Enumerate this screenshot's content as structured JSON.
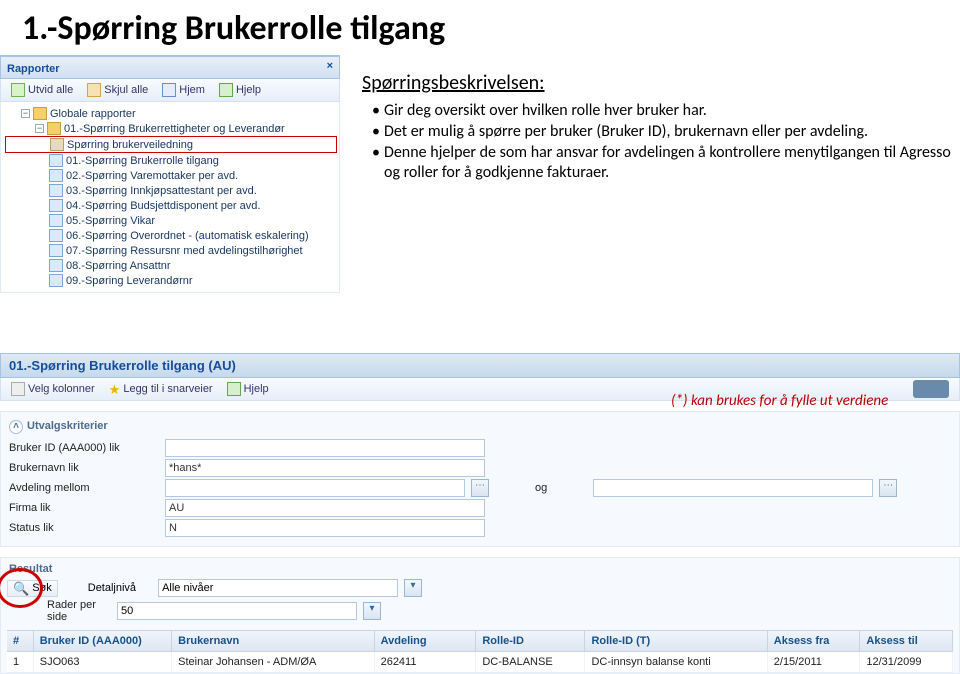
{
  "page_title": "1.-Spørring Brukerrolle tilgang",
  "reports_panel": {
    "title": "Rapporter",
    "close_glyph": "×",
    "toolbar": {
      "expand": "Utvid alle",
      "collapse": "Skjul alle",
      "home": "Hjem",
      "help": "Hjelp"
    },
    "tree": {
      "root": "Globale rapporter",
      "group": "01.-Spørring Brukerrettigheter og Leverandør",
      "highlighted": "Spørring brukerveiledning",
      "items": [
        "01.-Spørring Brukerrolle tilgang",
        "02.-Spørring Varemottaker per avd.",
        "03.-Spørring Innkjøpsattestant per avd.",
        "04.-Spørring Budsjettdisponent per avd.",
        "05.-Spørring Vikar",
        "06.-Spørring Overordnet - (automatisk eskalering)",
        "07.-Spørring Ressursnr med avdelingstilhørighet",
        "08.-Spørring Ansattnr",
        "09.-Spøring Leverandørnr"
      ]
    }
  },
  "description": {
    "heading": "Spørringsbeskrivelsen:",
    "lines": [
      "Gir deg oversikt over hvilken rolle hver bruker har.",
      "Det er mulig å spørre per bruker (Bruker ID), brukernavn eller per avdeling.",
      "Denne hjelper de som har ansvar for avdelingen å kontrollere menytilgangen til Agresso og roller for å godkjenne fakturaer."
    ]
  },
  "section": {
    "title": "01.-Spørring Brukerrolle tilgang (AU)",
    "toolbar": {
      "cols": "Velg kolonner",
      "fav": "Legg til i snarveier",
      "help": "Hjelp"
    }
  },
  "criteria": {
    "title": "Utvalgskriterier",
    "rows": {
      "user_id": {
        "label": "Bruker ID (AAA000) lik",
        "value": ""
      },
      "user_name": {
        "label": "Brukernavn lik",
        "value": "*hans*"
      },
      "dept": {
        "label": "Avdeling mellom",
        "value": "",
        "og": "og",
        "value2": ""
      },
      "firma": {
        "label": "Firma lik",
        "value": "AU"
      },
      "status": {
        "label": "Status lik",
        "value": "N"
      }
    }
  },
  "hint": "(*) kan brukes for å fylle ut  verdiene",
  "result": {
    "title": "Resultat",
    "sok": "Søk",
    "level_label": "Detaljnivå",
    "level_value": "Alle nivåer",
    "rows_label": "Rader per side",
    "rows_value": "50",
    "headers": [
      "#",
      "Bruker ID (AAA000)",
      "Brukernavn",
      "Avdeling",
      "Rolle-ID",
      "Rolle-ID (T)",
      "Aksess fra",
      "Aksess til"
    ],
    "row1": [
      "1",
      "SJO063",
      "Steinar Johansen - ADM/ØA",
      "262411",
      "DC-BALANSE",
      "DC-innsyn balanse konti",
      "2/15/2011",
      "12/31/2099"
    ]
  }
}
